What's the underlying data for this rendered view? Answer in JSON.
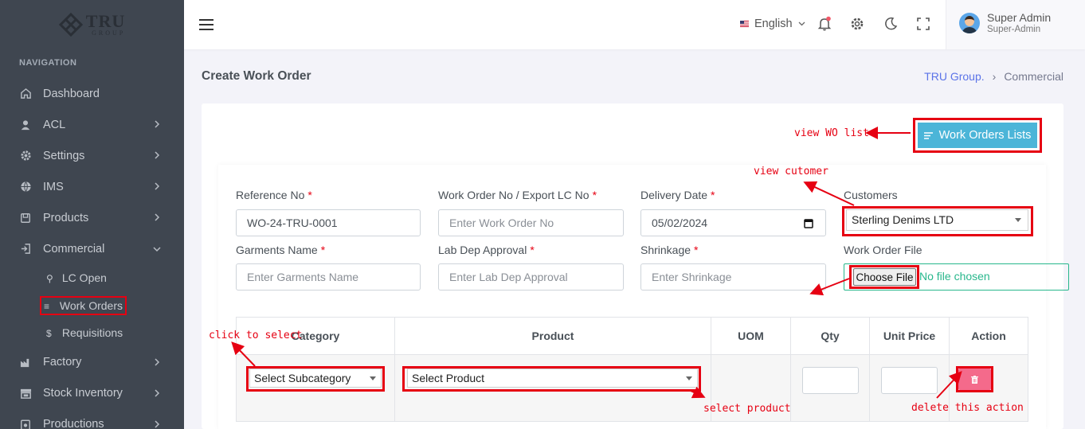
{
  "brand": {
    "name": "TRU",
    "sub": "GROUP"
  },
  "sidebar": {
    "section_title": "NAVIGATION",
    "items": [
      {
        "label": "Dashboard",
        "icon": "home-icon",
        "has_chevron": false
      },
      {
        "label": "ACL",
        "icon": "user-icon",
        "has_chevron": true
      },
      {
        "label": "Settings",
        "icon": "gear-icon",
        "has_chevron": true
      },
      {
        "label": "IMS",
        "icon": "globe-icon",
        "has_chevron": true
      },
      {
        "label": "Products",
        "icon": "box-icon",
        "has_chevron": true
      },
      {
        "label": "Commercial",
        "icon": "sign-in-icon",
        "has_chevron": true,
        "expanded": true
      }
    ],
    "sub_items": [
      {
        "label": "LC Open",
        "icon": "paperclip-icon"
      },
      {
        "label": "Work Orders",
        "icon": "list-icon",
        "active": true
      },
      {
        "label": "Requisitions",
        "icon": "dollar-icon"
      }
    ],
    "items_after": [
      {
        "label": "Factory",
        "icon": "factory-icon"
      },
      {
        "label": "Stock Inventory",
        "icon": "store-icon"
      },
      {
        "label": "Productions",
        "icon": "clipboard-icon"
      }
    ]
  },
  "topbar": {
    "language": "English",
    "user_name": "Super Admin",
    "user_role": "Super-Admin"
  },
  "page": {
    "title": "Create Work Order",
    "breadcrumb": [
      "TRU Group.",
      "Commercial"
    ]
  },
  "actions": {
    "work_orders_lists": "Work Orders Lists"
  },
  "form": {
    "reference_no": {
      "label": "Reference No",
      "value": "WO-24-TRU-0001",
      "required": "*"
    },
    "work_order_no": {
      "label": "Work Order No / Export LC No",
      "placeholder": "Enter Work Order No",
      "required": "*"
    },
    "delivery_date": {
      "label": "Delivery Date",
      "value": "05/02/2024",
      "required": "*"
    },
    "customers": {
      "label": "Customers",
      "value": "Sterling Denims LTD"
    },
    "garments_name": {
      "label": "Garments Name",
      "placeholder": "Enter Garments Name",
      "required": "*"
    },
    "lab_dep_approval": {
      "label": "Lab Dep Approval",
      "placeholder": "Enter Lab Dep Approval",
      "required": "*"
    },
    "shrinkage": {
      "label": "Shrinkage",
      "placeholder": "Enter Shrinkage",
      "required": "*"
    },
    "work_order_file": {
      "label": "Work Order File",
      "button": "Choose File",
      "status": "No file chosen"
    }
  },
  "table": {
    "headers": [
      "Category",
      "Product",
      "UOM",
      "Qty",
      "Unit Price",
      "Action"
    ],
    "row": {
      "category": "Select Subcategory",
      "product": "Select Product"
    }
  },
  "annotations": {
    "view_wo_list": "view WO list",
    "view_customer": "view cutomer",
    "click_to_select": "click to select",
    "select_product": "select product",
    "delete_action": "delete this action"
  },
  "colors": {
    "sidebar_bg": "#3f4650",
    "accent_button": "#4bb5d8",
    "annotation": "#e60012",
    "danger_button": "#f46a8b",
    "file_border": "#28b78c"
  }
}
